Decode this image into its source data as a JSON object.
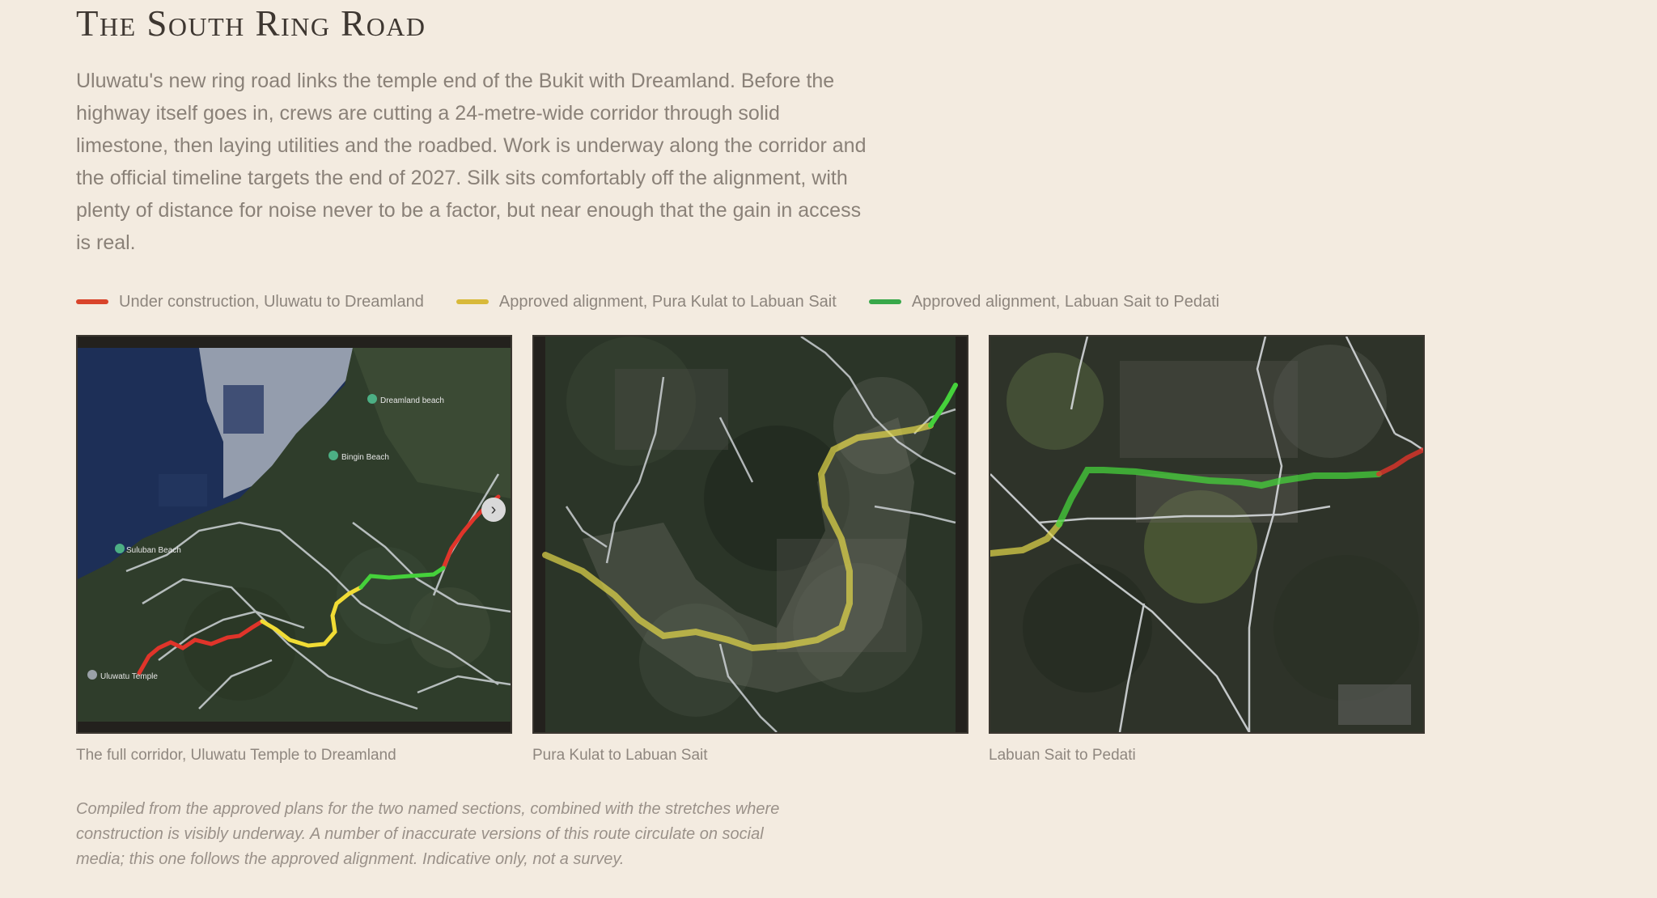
{
  "title": "The South Ring Road",
  "intro": "Uluwatu's new ring road links the temple end of the Bukit with Dreamland. Before the highway itself goes in, crews are cutting a 24-metre-wide corridor through solid limestone, then laying utilities and the roadbed. Work is underway along the corridor and the official timeline targets the end of 2027. Silk sits comfortably off the alignment, with plenty of distance for noise never to be a factor, but near enough that the gain in access is real.",
  "legend": [
    {
      "label": "Under construction, Uluwatu to Dreamland",
      "color": "#d9442b"
    },
    {
      "label": "Approved alignment, Pura Kulat to Labuan Sait",
      "color": "#d8b93a"
    },
    {
      "label": "Approved alignment, Labuan Sait to Pedati",
      "color": "#38a84a"
    }
  ],
  "maps": [
    {
      "caption": "The full corridor, Uluwatu Temple to Dreamland",
      "places": [
        "Dreamland beach",
        "Bingin Beach",
        "Suluban Beach",
        "Uluwatu Temple"
      ],
      "nav_icon": "chevron-right-icon"
    },
    {
      "caption": "Pura Kulat to Labuan Sait",
      "places": []
    },
    {
      "caption": "Labuan Sait to Pedati",
      "places": []
    }
  ],
  "note": "Compiled from the approved plans for the two named sections, combined with the stretches where construction is visibly underway. A number of inaccurate versions of this route circulate on social media; this one follows the approved alignment. Indicative only, not a survey."
}
